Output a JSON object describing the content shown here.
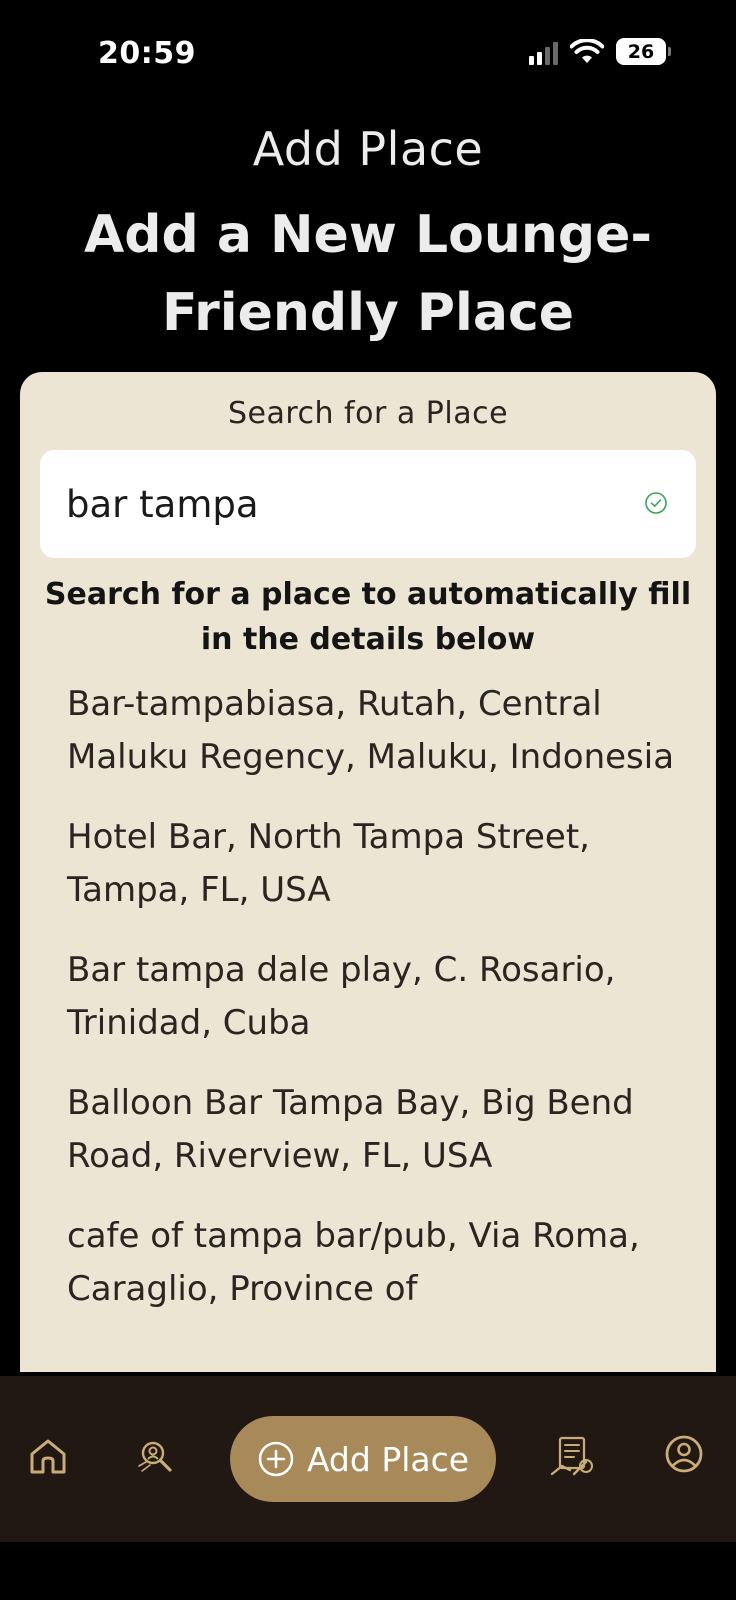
{
  "status_bar": {
    "time": "20:59",
    "battery": "26",
    "icons": [
      "signal-icon",
      "wifi-icon",
      "battery-icon"
    ]
  },
  "nav": {
    "title": "Add Place"
  },
  "page": {
    "heading": "Add a New Lounge-Friendly Place"
  },
  "search": {
    "label": "Search for a Place",
    "value": "bar tampa",
    "status_icon": "check-circle-icon",
    "helper": "Search for a place to automatically fill in the details below"
  },
  "results": [
    "Bar-tampabiasa, Rutah, Central Maluku Regency, Maluku, Indonesia",
    "Hotel Bar, North Tampa Street, Tampa, FL, USA",
    "Bar tampa dale play, C. Rosario, Trinidad, Cuba",
    "Balloon Bar Tampa Bay, Big Bend Road, Riverview, FL, USA",
    "cafe of tampa bar/pub, Via Roma, Caraglio, Province of"
  ],
  "tab_bar": {
    "add_label": "Add Place",
    "icons": [
      "home-icon",
      "explore-icon",
      "plus-circle-icon",
      "list-icon",
      "profile-icon"
    ]
  },
  "colors": {
    "background": "#000000",
    "card": "#ede5d3",
    "accent": "#a88a5a",
    "tab_bar": "#221813",
    "tab_icon": "#c9ad78",
    "success": "#3aa35a"
  }
}
